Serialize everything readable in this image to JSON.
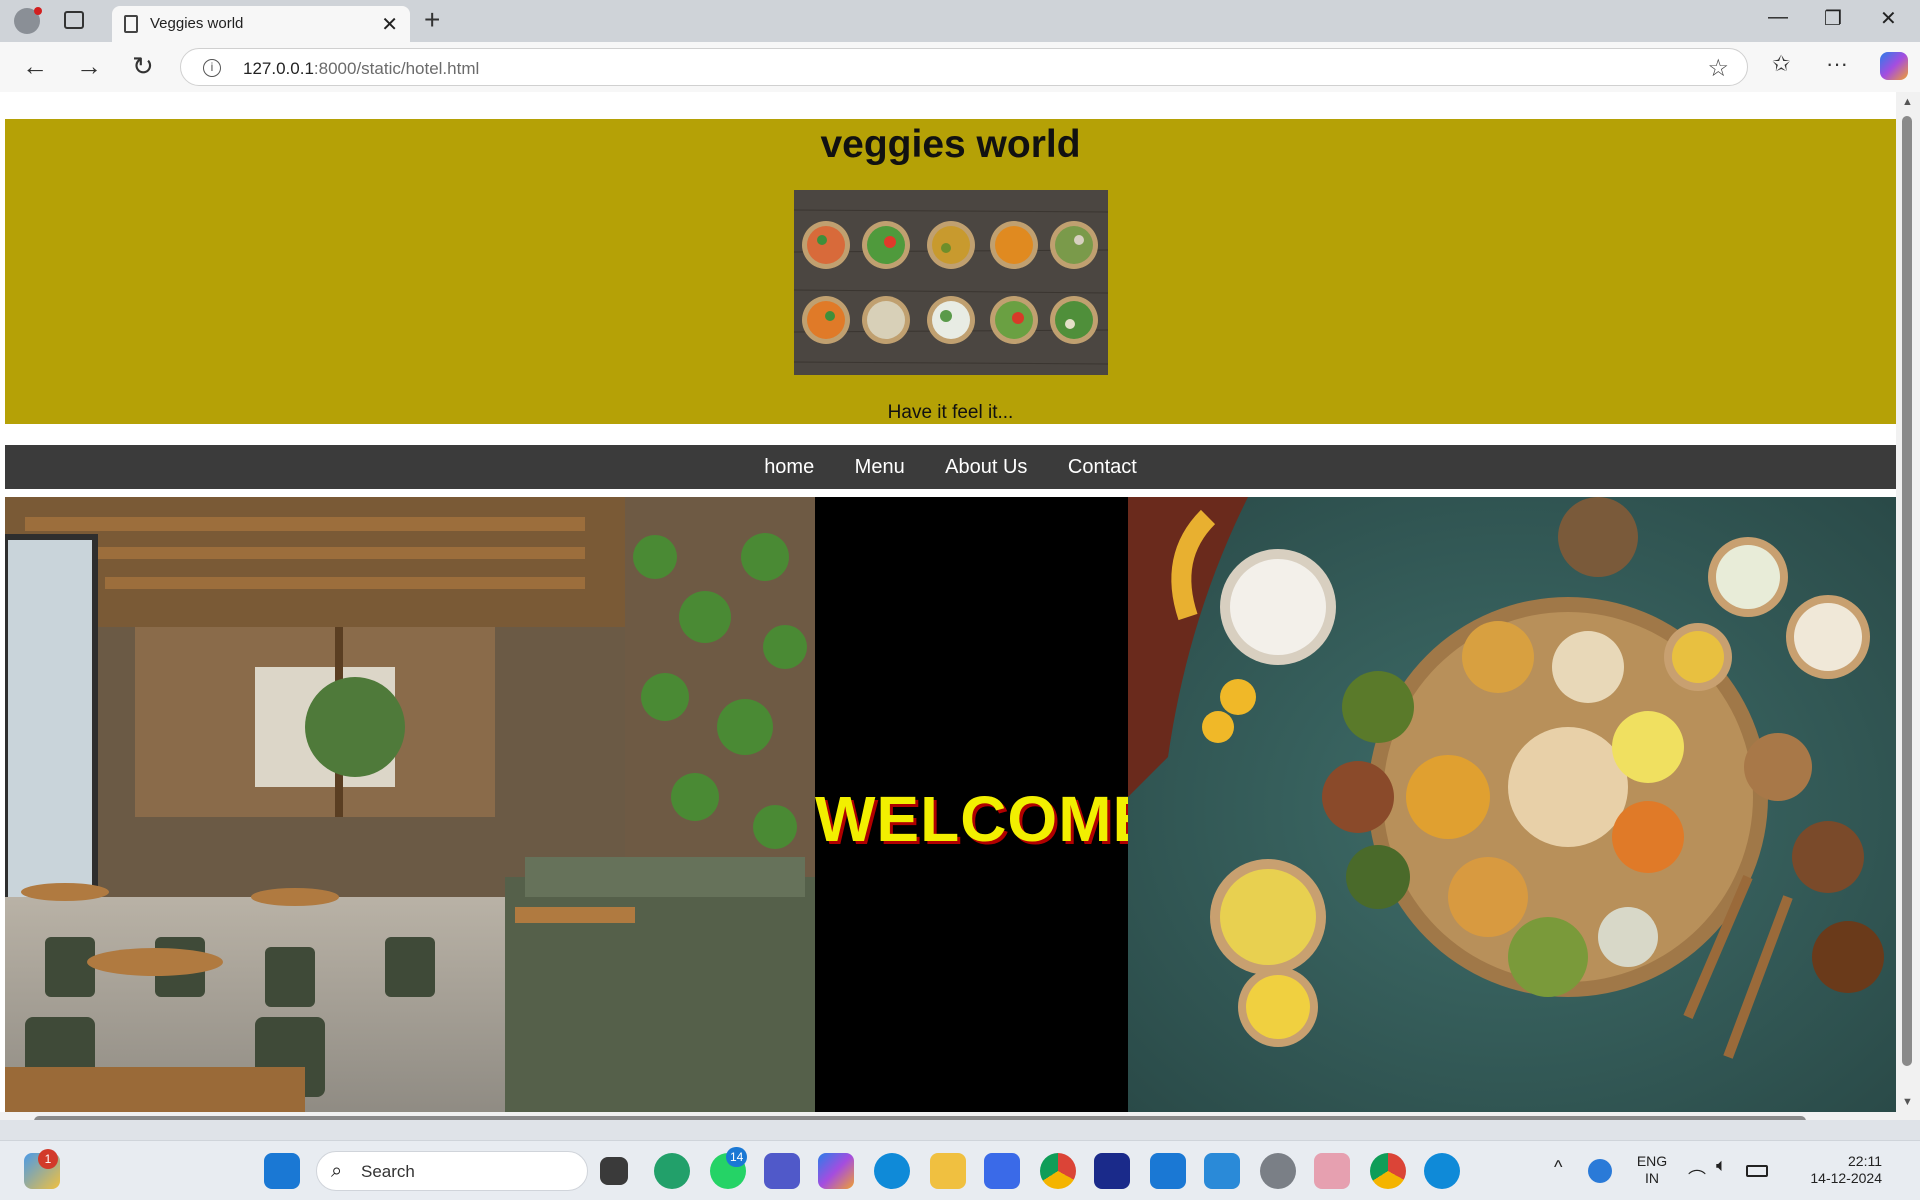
{
  "browser": {
    "tab_title": "Veggies world",
    "url_host": "127.0.0.1",
    "url_rest": ":8000/static/hotel.html",
    "new_tab_glyph": "+",
    "close_glyph": "✕",
    "minimize_glyph": "—",
    "restore_glyph": "❐",
    "window_close_glyph": "✕",
    "back_glyph": "←",
    "forward_glyph": "→",
    "reload_glyph": "↻",
    "favorite_glyph": "☆",
    "favorites_glyph": "✩",
    "more_glyph": "···"
  },
  "site": {
    "title": "veggies world",
    "tagline": "Have it feel it...",
    "welcome": "WELCOME"
  },
  "nav": {
    "items": [
      {
        "label": "home"
      },
      {
        "label": "Menu"
      },
      {
        "label": "About Us"
      },
      {
        "label": "Contact"
      }
    ]
  },
  "taskbar": {
    "search_label": "Search",
    "weather_badge": "1",
    "whatsapp_badge": "14",
    "lang_top": "ENG",
    "lang_bottom": "IN",
    "time": "22:11",
    "date": "14-12-2024",
    "chevron_glyph": "^"
  },
  "colors": {
    "header_band": "#b5a106",
    "navbar": "#3b3b3b",
    "welcome_text": "#f2ef00",
    "welcome_shadow": "#b00000"
  }
}
